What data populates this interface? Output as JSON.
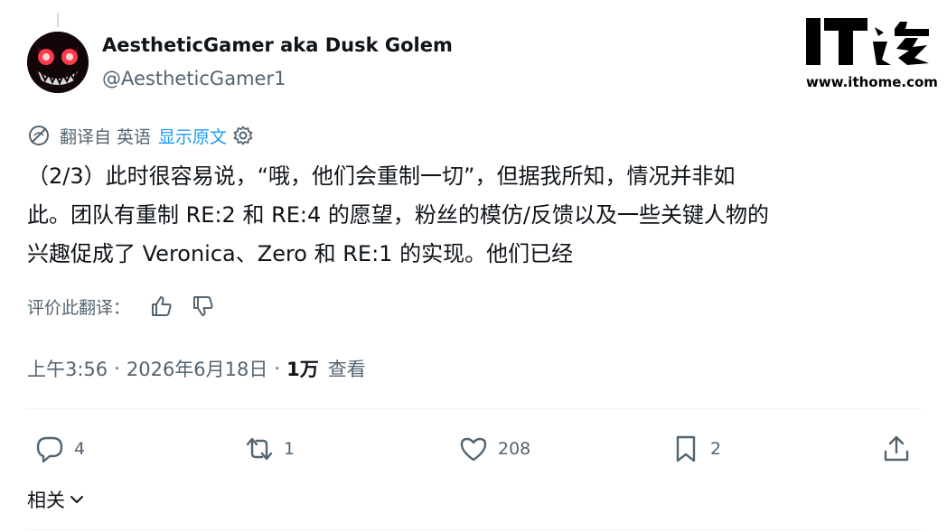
{
  "author": {
    "display_name": "AestheticGamer aka Dusk Golem",
    "handle": "@AestheticGamer1",
    "avatar_icon": "demon-face-avatar"
  },
  "watermark": {
    "logo_text": "IT之家",
    "url": "www.ithome.com"
  },
  "translation": {
    "icon": "translate-globe-icon",
    "label": "翻译自 英语",
    "show_original": "显示原文",
    "settings_icon": "gear-icon"
  },
  "tweet": {
    "lines": [
      "（2/3）此时很容易说，“哦，他们会重制一切”，但据我所知，情况并非如",
      "此。团队有重制 RE:2 和 RE:4 的愿望，粉丝的模仿/反馈以及一些关键人物的",
      "兴趣促成了 Veronica、Zero 和 RE:1 的实现。他们已经"
    ]
  },
  "rate_translation": {
    "label": "评价此翻译：",
    "up_icon": "thumbs-up-icon",
    "down_icon": "thumbs-down-icon"
  },
  "meta": {
    "time": "上午3:56",
    "separator": "·",
    "date": "2026年6月18日",
    "views_count": "1万",
    "views_label": "查看"
  },
  "actions": {
    "reply": {
      "icon": "reply-icon",
      "count": "4"
    },
    "retweet": {
      "icon": "retweet-icon",
      "count": "1"
    },
    "like": {
      "icon": "heart-icon",
      "count": "208"
    },
    "bookmark": {
      "icon": "bookmark-icon",
      "count": "2"
    },
    "share": {
      "icon": "share-icon"
    }
  },
  "related": {
    "label": "相关",
    "icon": "chevron-down-icon"
  },
  "colors": {
    "text_primary": "#0f1419",
    "text_secondary": "#536471",
    "link_blue": "#1d9bf0",
    "divider": "#eff3f4"
  }
}
